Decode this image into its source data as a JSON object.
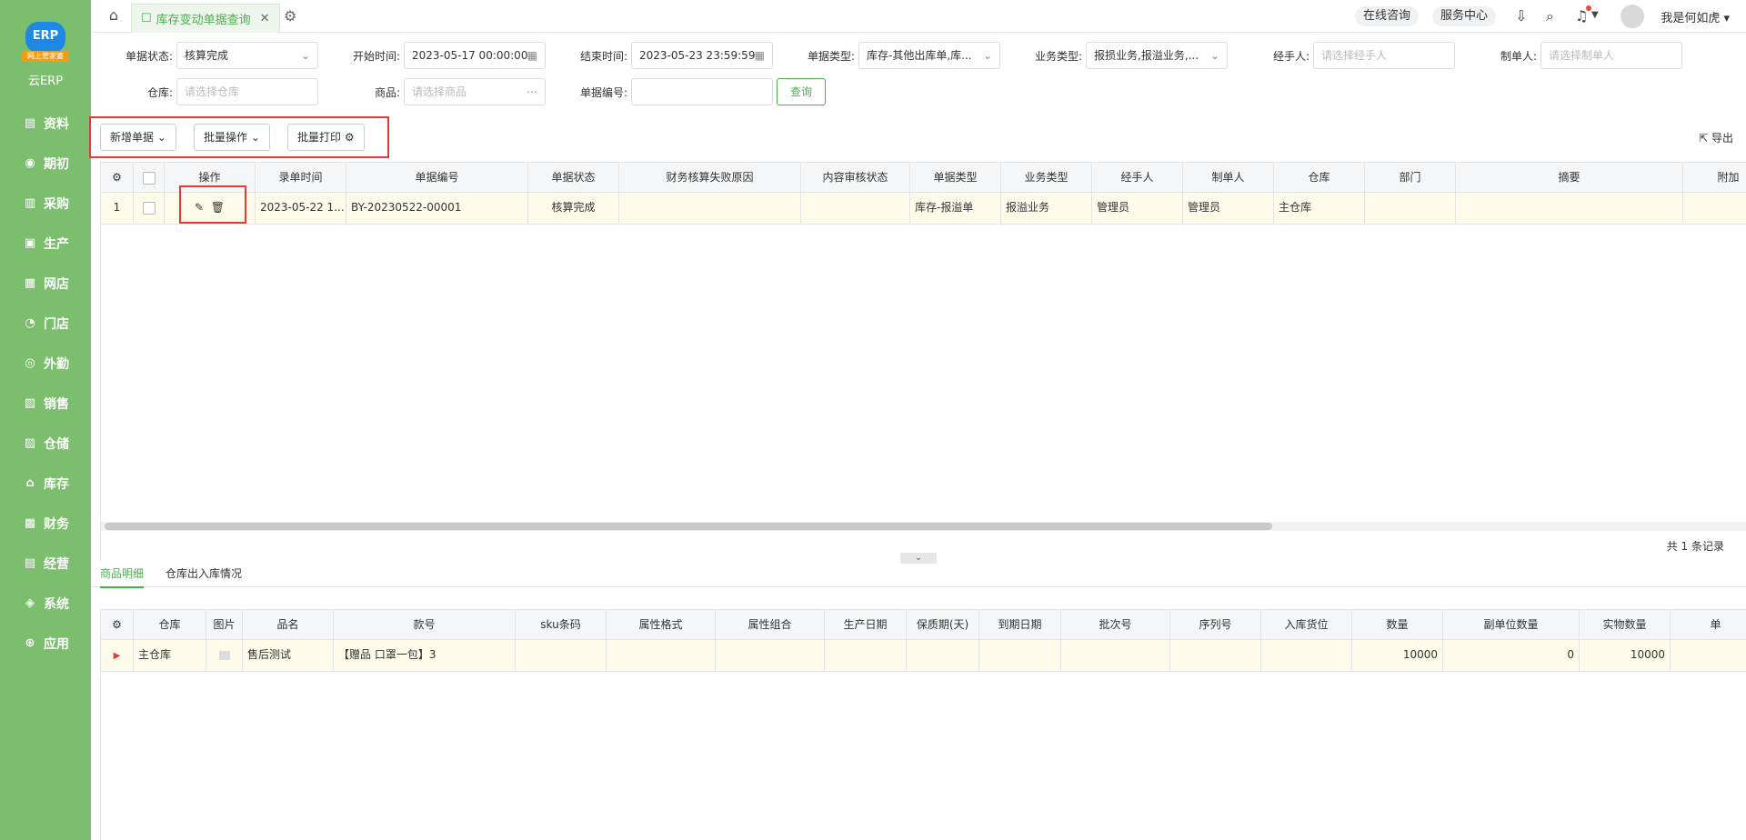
{
  "sidebar": {
    "logo_main": "ERP",
    "logo_ribbon": "网上管家婆",
    "logo_text": "云ERP",
    "items": [
      {
        "label": "资料",
        "icon": "▤"
      },
      {
        "label": "期初",
        "icon": "◉"
      },
      {
        "label": "采购",
        "icon": "▥"
      },
      {
        "label": "生产",
        "icon": "▣"
      },
      {
        "label": "网店",
        "icon": "▦"
      },
      {
        "label": "门店",
        "icon": "◔"
      },
      {
        "label": "外勤",
        "icon": "◎"
      },
      {
        "label": "销售",
        "icon": "▧"
      },
      {
        "label": "仓储",
        "icon": "▨"
      },
      {
        "label": "库存",
        "icon": "⌂"
      },
      {
        "label": "财务",
        "icon": "▩"
      },
      {
        "label": "经营",
        "icon": "▤"
      },
      {
        "label": "系统",
        "icon": "◈"
      },
      {
        "label": "应用",
        "icon": "⊕"
      }
    ]
  },
  "topbar": {
    "tab_label": "库存变动单据查询",
    "online_consult": "在线咨询",
    "service_center": "服务中心",
    "user_name": "我是何如虎"
  },
  "filters": {
    "doc_status_label": "单据状态:",
    "doc_status_value": "核算完成",
    "start_time_label": "开始时间:",
    "start_time_value": "2023-05-17 00:00:00",
    "end_time_label": "结束时间:",
    "end_time_value": "2023-05-23 23:59:59",
    "doc_type_label": "单据类型:",
    "doc_type_value": "库存-其他出库单,库...",
    "biz_type_label": "业务类型:",
    "biz_type_value": "报损业务,报溢业务,...",
    "handler_label": "经手人:",
    "handler_placeholder": "请选择经手人",
    "maker_label": "制单人:",
    "maker_placeholder": "请选择制单人",
    "warehouse_label": "仓库:",
    "warehouse_placeholder": "请选择仓库",
    "product_label": "商品:",
    "product_placeholder": "请选择商品",
    "doc_no_label": "单据编号:",
    "query_button": "查询"
  },
  "toolbar": {
    "new_doc": "新增单据",
    "batch_ops": "批量操作",
    "batch_print": "批量打印",
    "export": "导出"
  },
  "main_table": {
    "columns": [
      "操作",
      "录单时间",
      "单据编号",
      "单据状态",
      "财务核算失败原因",
      "内容审核状态",
      "单据类型",
      "业务类型",
      "经手人",
      "制单人",
      "仓库",
      "部门",
      "摘要",
      "附加"
    ],
    "rows": [
      {
        "index": "1",
        "time": "2023-05-22 1...",
        "doc_no": "BY-20230522-00001",
        "status": "核算完成",
        "fail_reason": "",
        "audit_status": "",
        "doc_type": "库存-报溢单",
        "biz_type": "报溢业务",
        "handler": "管理员",
        "maker": "管理员",
        "warehouse": "主仓库",
        "dept": "",
        "summary": ""
      }
    ],
    "record_count": "共 1 条记录"
  },
  "sub_tabs": [
    "商品明细",
    "仓库出入库情况"
  ],
  "detail_table": {
    "columns": [
      "仓库",
      "图片",
      "品名",
      "款号",
      "sku条码",
      "属性格式",
      "属性组合",
      "生产日期",
      "保质期(天)",
      "到期日期",
      "批次号",
      "序列号",
      "入库货位",
      "数量",
      "副单位数量",
      "实物数量",
      "单"
    ],
    "rows": [
      {
        "warehouse": "主仓库",
        "name": "售后测试",
        "style_no": "【赠品 口罩一包】3",
        "qty": "10000",
        "sub_qty": "0",
        "actual_qty": "10000"
      }
    ]
  }
}
